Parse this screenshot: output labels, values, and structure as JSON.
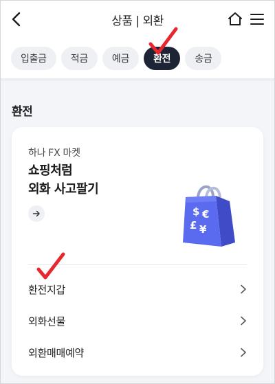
{
  "header": {
    "title": "상품 | 외환",
    "back_icon": "chevron-left-icon",
    "home_icon": "home-icon",
    "menu_icon": "hamburger-menu-icon"
  },
  "tabs": [
    {
      "label": "입출금",
      "active": false
    },
    {
      "label": "적금",
      "active": false
    },
    {
      "label": "예금",
      "active": false
    },
    {
      "label": "환전",
      "active": true
    },
    {
      "label": "송금",
      "active": false
    }
  ],
  "section": {
    "title": "환전"
  },
  "promo": {
    "subtitle": "하나 FX 마켓",
    "headline_line1": "쇼핑처럼",
    "headline_line2": "외화 사고팔기",
    "arrow_icon": "arrow-right-icon",
    "image_icon": "currency-shopping-bag-icon"
  },
  "menu": [
    {
      "label": "환전지갑"
    },
    {
      "label": "외화선물"
    },
    {
      "label": "외환매매예약"
    }
  ],
  "colors": {
    "accent_dark": "#1d2436",
    "checkmark": "#e8262e",
    "bag": "#5b6bf0"
  }
}
